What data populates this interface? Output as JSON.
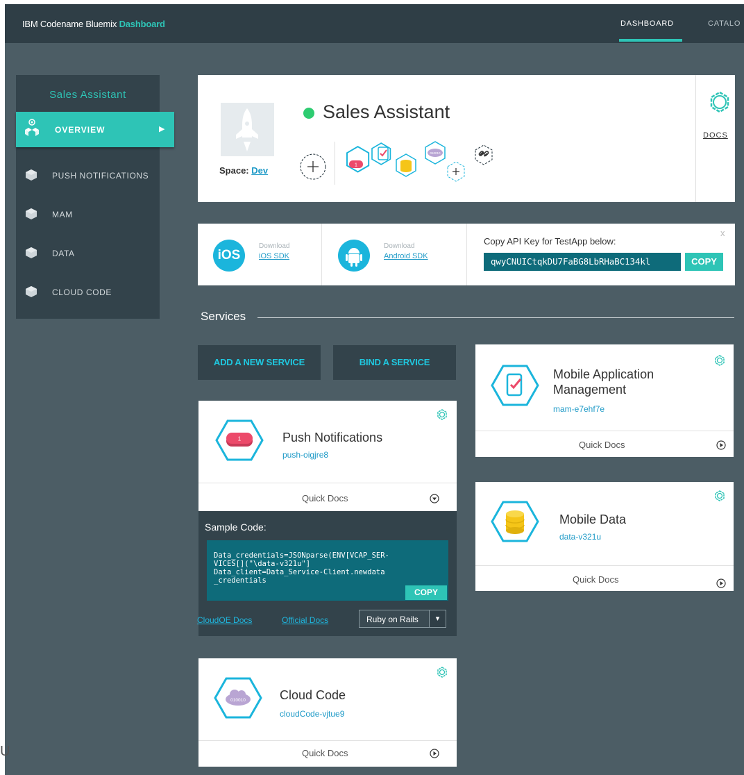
{
  "topbar": {
    "brand": "IBM Codename Bluemix",
    "brand_highlight": "Dashboard",
    "nav_active": "DASHBOARD",
    "nav_catalog": "CATALO"
  },
  "sidebar": {
    "title": "Sales Assistant",
    "items": [
      {
        "label": "OVERVIEW",
        "icon": "overview-icon",
        "active": true
      },
      {
        "label": "PUSH NOTIFICATIONS",
        "icon": "push-icon"
      },
      {
        "label": "MAM",
        "icon": "mam-icon"
      },
      {
        "label": "DATA",
        "icon": "data-icon"
      },
      {
        "label": "CLOUD CODE",
        "icon": "cloud-code-icon"
      }
    ]
  },
  "app": {
    "name": "Sales Assistant",
    "space_label": "Space:",
    "space_value": "Dev",
    "docs_label": "DOCS",
    "status_color": "#2ecc71"
  },
  "sdk": {
    "ios_badge": "iOS",
    "ios_download": "Download",
    "ios_link": "iOS SDK",
    "android_download": "Download",
    "android_link": "Android SDK",
    "api_label": "Copy API Key for TestApp below:",
    "api_key": "qwyCNUICtqkDU7FaBG8LbRHaBC134kl",
    "copy_label": "COPY",
    "close_label": "x"
  },
  "services": {
    "title": "Services",
    "add_button": "ADD A NEW SERVICE",
    "bind_button": "BIND A SERVICE",
    "quick_docs": "Quick Docs",
    "push": {
      "name": "Push Notifications",
      "id": "push-oigjre8",
      "badge": "1"
    },
    "mam": {
      "name_line1": "Mobile Application",
      "name_line2": "Management",
      "id": "mam-e7ehf7e"
    },
    "data": {
      "name": "Mobile Data",
      "id": "data-v321u"
    },
    "cloud": {
      "name": "Cloud Code",
      "id": "cloudCode-vjtue9",
      "badge": "010010"
    }
  },
  "sample": {
    "title": "Sample Code:",
    "code": "Data_credentials=JSONparse(ENV[VCAP_SER-\nVICES[](\"\\data-v321u\"]\nData_client=Data_Service-Client.newdata\n_credentials",
    "copy_label": "COPY",
    "link_cloudoe": "CloudOE Docs",
    "link_official": "Official Docs",
    "framework": "Ruby on Rails"
  },
  "stray_text": "U",
  "colors": {
    "accent": "#2ec4b6",
    "link": "#1e9ac7",
    "background": "#4c5d65",
    "panel": "#33434b",
    "code_bg": "#0e6b7a",
    "push_red": "#ec4a6a",
    "data_yellow": "#f5c518",
    "cloud_purple": "#b9a5d3"
  }
}
